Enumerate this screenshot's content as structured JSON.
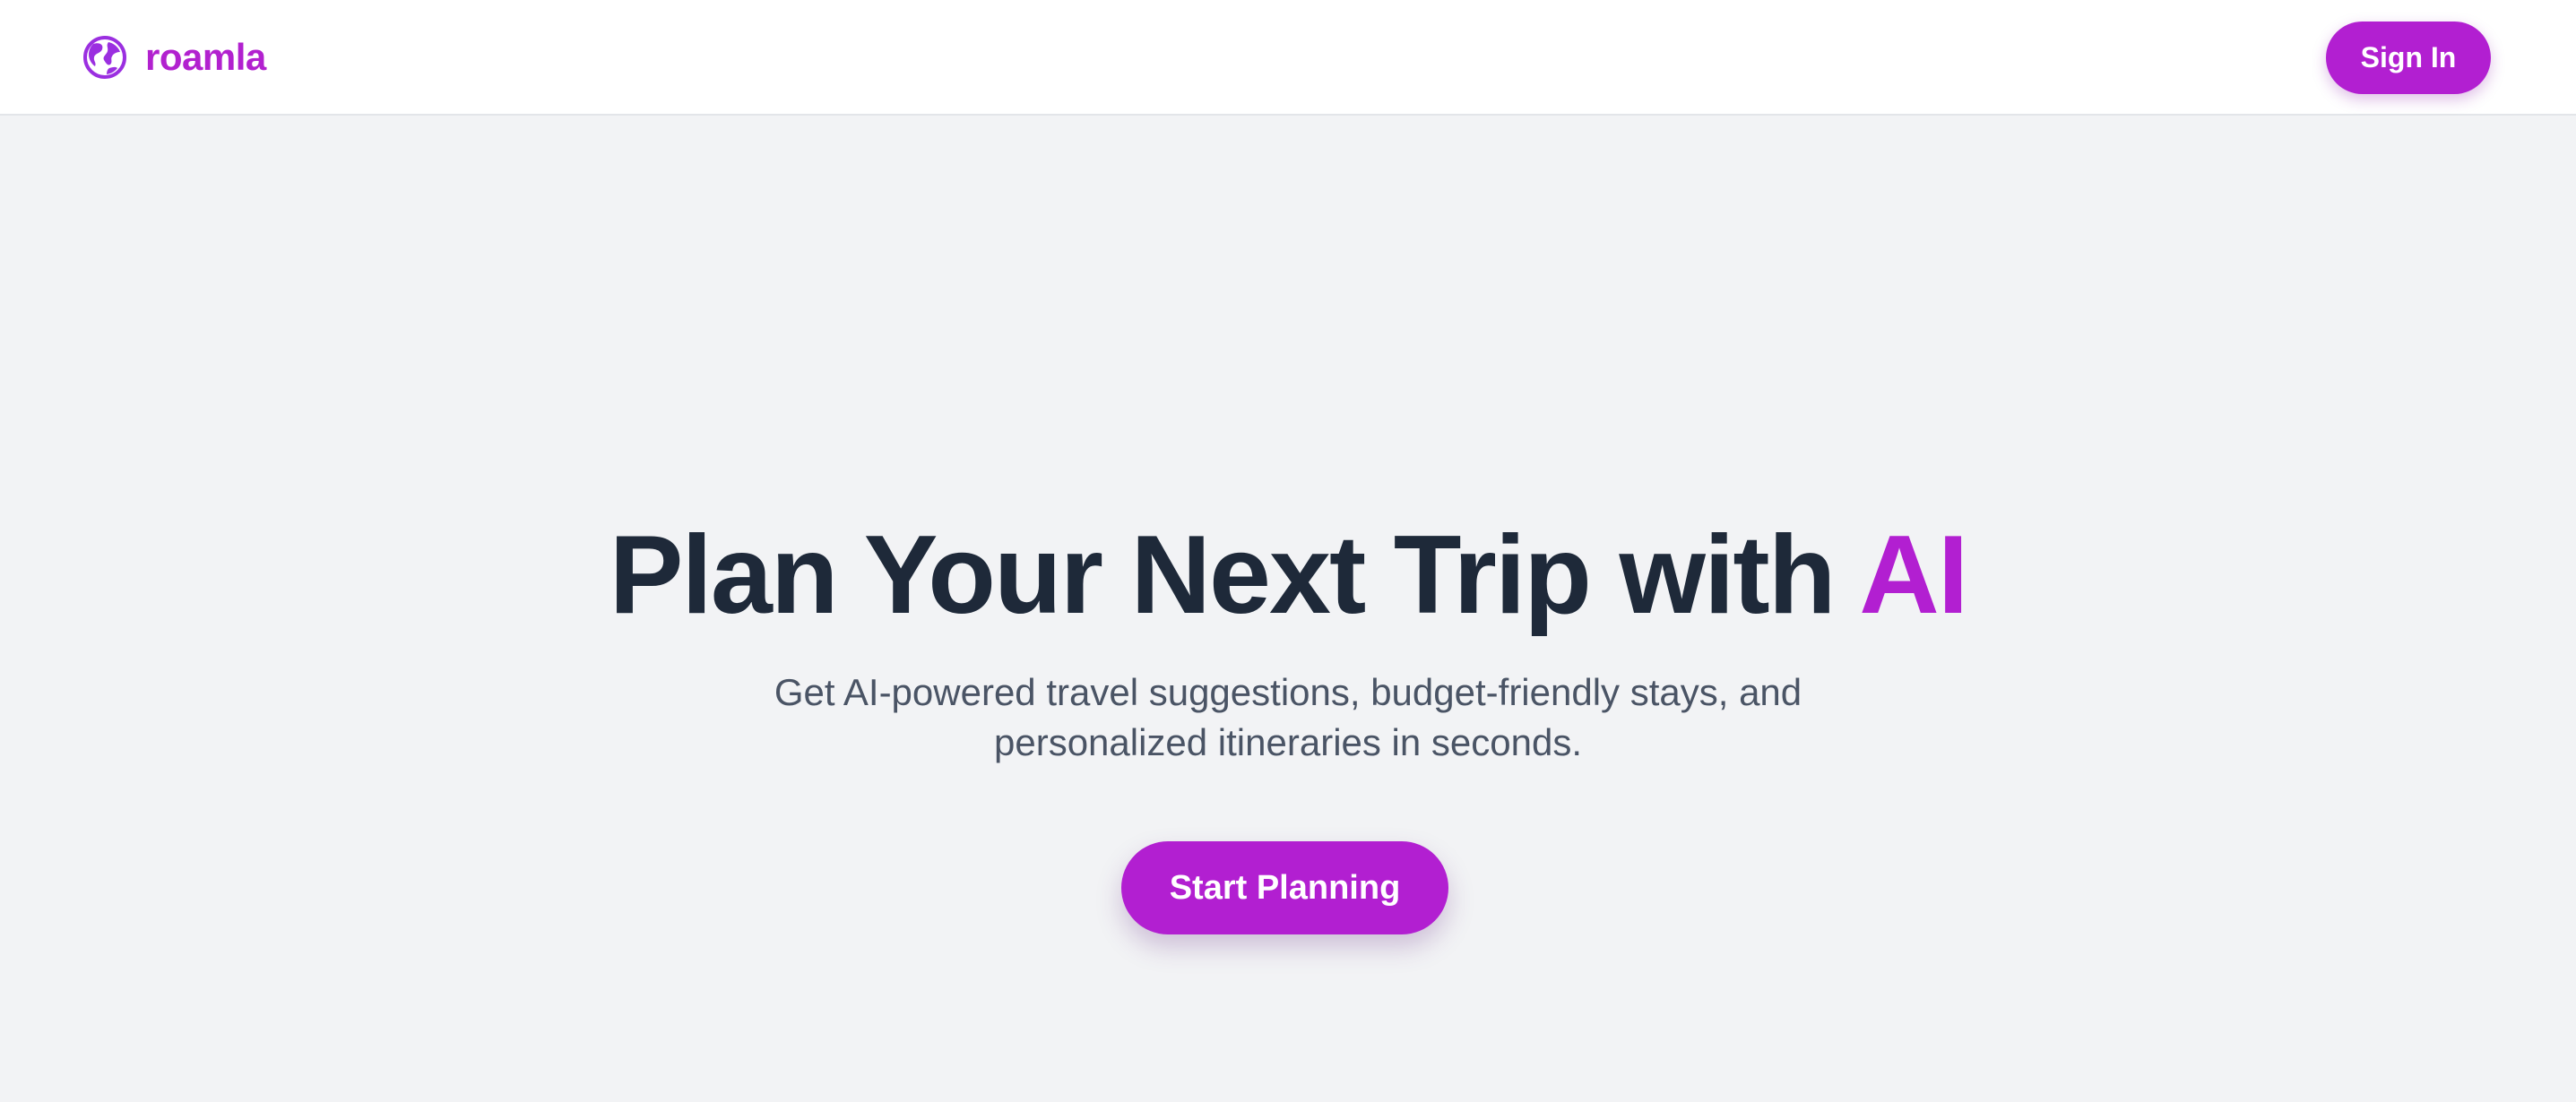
{
  "brand": {
    "name": "roamla",
    "icon": "globe-icon",
    "color": "#b221cf"
  },
  "nav": {
    "signin_label": "Sign In"
  },
  "hero": {
    "title_main": "Plan Your Next Trip with ",
    "title_accent": "AI",
    "subtitle": "Get AI-powered travel suggestions, budget-friendly stays, and personalized itineraries in seconds.",
    "cta_label": "Start Planning"
  },
  "colors": {
    "accent": "#b21fd1",
    "heading": "#1e2939",
    "body_text": "#4a5465",
    "background": "#f2f3f5",
    "navbar": "#ffffff"
  }
}
